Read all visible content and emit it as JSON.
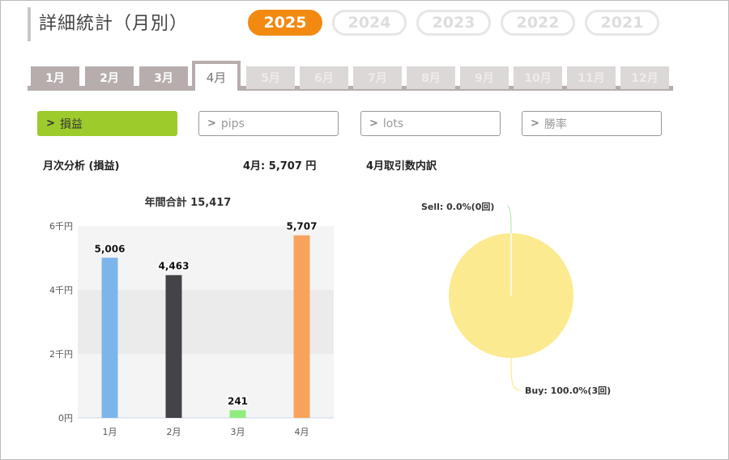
{
  "header": {
    "title": "詳細統計（月別）",
    "years": [
      "2025",
      "2024",
      "2023",
      "2022",
      "2021"
    ],
    "active_year": "2025"
  },
  "month_tabs": {
    "labels": [
      "1月",
      "2月",
      "3月",
      "4月",
      "5月",
      "6月",
      "7月",
      "8月",
      "9月",
      "10月",
      "11月",
      "12月"
    ],
    "active": "4月"
  },
  "metrics": {
    "buttons": [
      "損益",
      "pips",
      "lots",
      "勝率"
    ],
    "active": "損益"
  },
  "summary": {
    "monthly_heading": "月次分析 (損益)",
    "current_value": "4月:  5,707 円",
    "breakdown_heading": "4月取引数内訳"
  },
  "chart_data": [
    {
      "type": "bar",
      "title": "年間合計 15,417",
      "categories": [
        "1月",
        "2月",
        "3月",
        "4月"
      ],
      "values": [
        5006,
        4463,
        241,
        5707
      ],
      "value_labels": [
        "5,006",
        "4,463",
        "241",
        "5,707"
      ],
      "colors": [
        "#7cb5ec",
        "#434348",
        "#90ed7d",
        "#f7a35c"
      ],
      "yticks": [
        "0円",
        "2千円",
        "4千円",
        "6千円"
      ],
      "ylim": [
        0,
        6000
      ],
      "grid": "alternating bands"
    },
    {
      "type": "pie",
      "slices": [
        {
          "label": "Sell: 0.0%(0回)",
          "value": 0
        },
        {
          "label": "Buy: 100.0%(3回)",
          "value": 100
        }
      ],
      "colors": [
        "#a8e6a0",
        "#fbea8f"
      ]
    }
  ]
}
